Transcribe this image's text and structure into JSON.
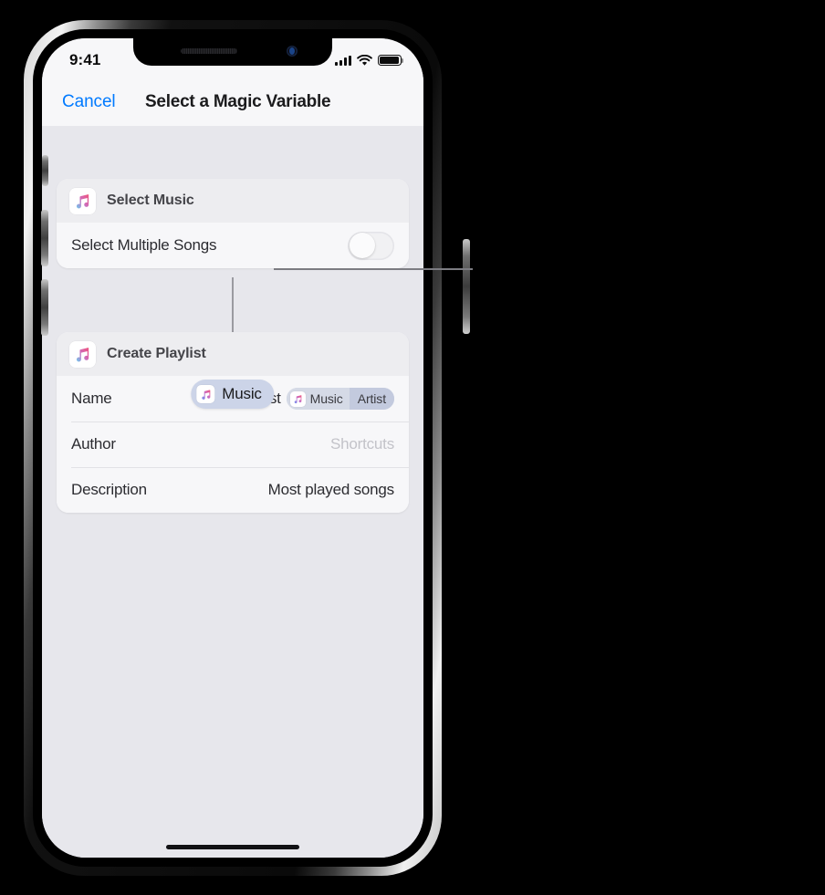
{
  "status_bar": {
    "time": "9:41",
    "cellular_icon": "signal-bars-icon",
    "wifi_icon": "wifi-icon",
    "battery_icon": "battery-full-icon"
  },
  "nav": {
    "cancel_label": "Cancel",
    "title": "Select a Magic Variable"
  },
  "cards": [
    {
      "icon": "music-app-icon",
      "title": "Select Music",
      "rows": [
        {
          "label": "Select Multiple Songs",
          "control": "toggle",
          "toggle_on": false
        }
      ]
    },
    {
      "icon": "music-app-icon",
      "title": "Create Playlist",
      "rows": [
        {
          "label": "Name",
          "value_text": "Top 25 Most",
          "token": {
            "icon": "music-app-icon",
            "primary": "Music",
            "secondary": "Artist"
          }
        },
        {
          "label": "Author",
          "value_text": "Shortcuts",
          "is_placeholder": true
        },
        {
          "label": "Description",
          "value_text": "Most played songs",
          "is_placeholder": false
        }
      ]
    }
  ],
  "magic_variable_pill": {
    "icon": "music-app-icon",
    "label": "Music"
  },
  "callout": {
    "name": "callout-line-to-music-variable"
  },
  "colors": {
    "accent_blue": "#007aff",
    "screen_background": "#e7e7ec",
    "card_background": "#f7f7f9",
    "card_header_background": "#ededf0",
    "variable_pill_background": "#ccd4e8",
    "token_background": "#ccd2e0",
    "placeholder_text": "#c3c3c9",
    "connector_line": "#9a9aa0"
  }
}
